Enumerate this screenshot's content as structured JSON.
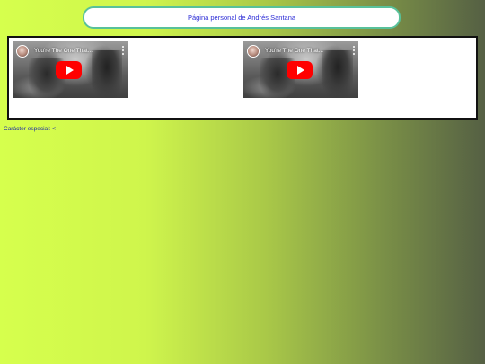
{
  "header": {
    "title": "Página personal de Andrés Santana"
  },
  "videos": [
    {
      "title": "You're The One That...",
      "play_icon": "youtube-play-icon",
      "menu_icon": "kebab-menu-icon"
    },
    {
      "title": "You're The One That...",
      "play_icon": "youtube-play-icon",
      "menu_icon": "kebab-menu-icon"
    }
  ],
  "special_char": {
    "label": "Carácter especial: <"
  },
  "colors": {
    "header_border": "#58c19a",
    "header_text": "#2b2bd6",
    "link_text": "#1f2ba8",
    "play_red": "#ff0000",
    "gradient_start": "#d6ff4d",
    "gradient_end": "#556044"
  }
}
